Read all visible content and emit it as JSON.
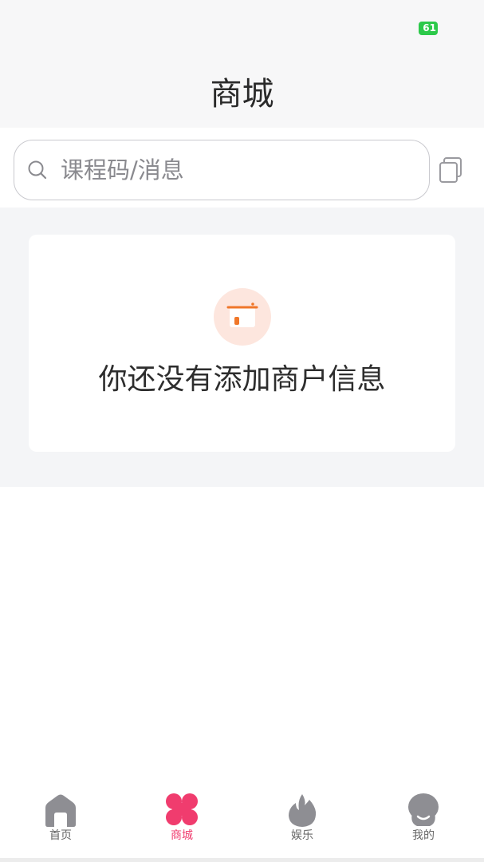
{
  "status_bar": {
    "battery_level": "61",
    "battery_color": "#2cc94a"
  },
  "header": {
    "title": "商城"
  },
  "search": {
    "placeholder": "课程码/消息"
  },
  "empty_state": {
    "message": "你还没有添加商户信息"
  },
  "tabs": [
    {
      "label": "首页",
      "icon": "home-icon",
      "active": false
    },
    {
      "label": "商城",
      "icon": "clover-icon",
      "active": true
    },
    {
      "label": "娱乐",
      "icon": "flame-icon",
      "active": false
    },
    {
      "label": "我的",
      "icon": "profile-face-icon",
      "active": false
    }
  ],
  "colors": {
    "accent": "#f03c6e",
    "shop_icon_bg": "#fde6de",
    "shop_icon": "#f0772a"
  }
}
